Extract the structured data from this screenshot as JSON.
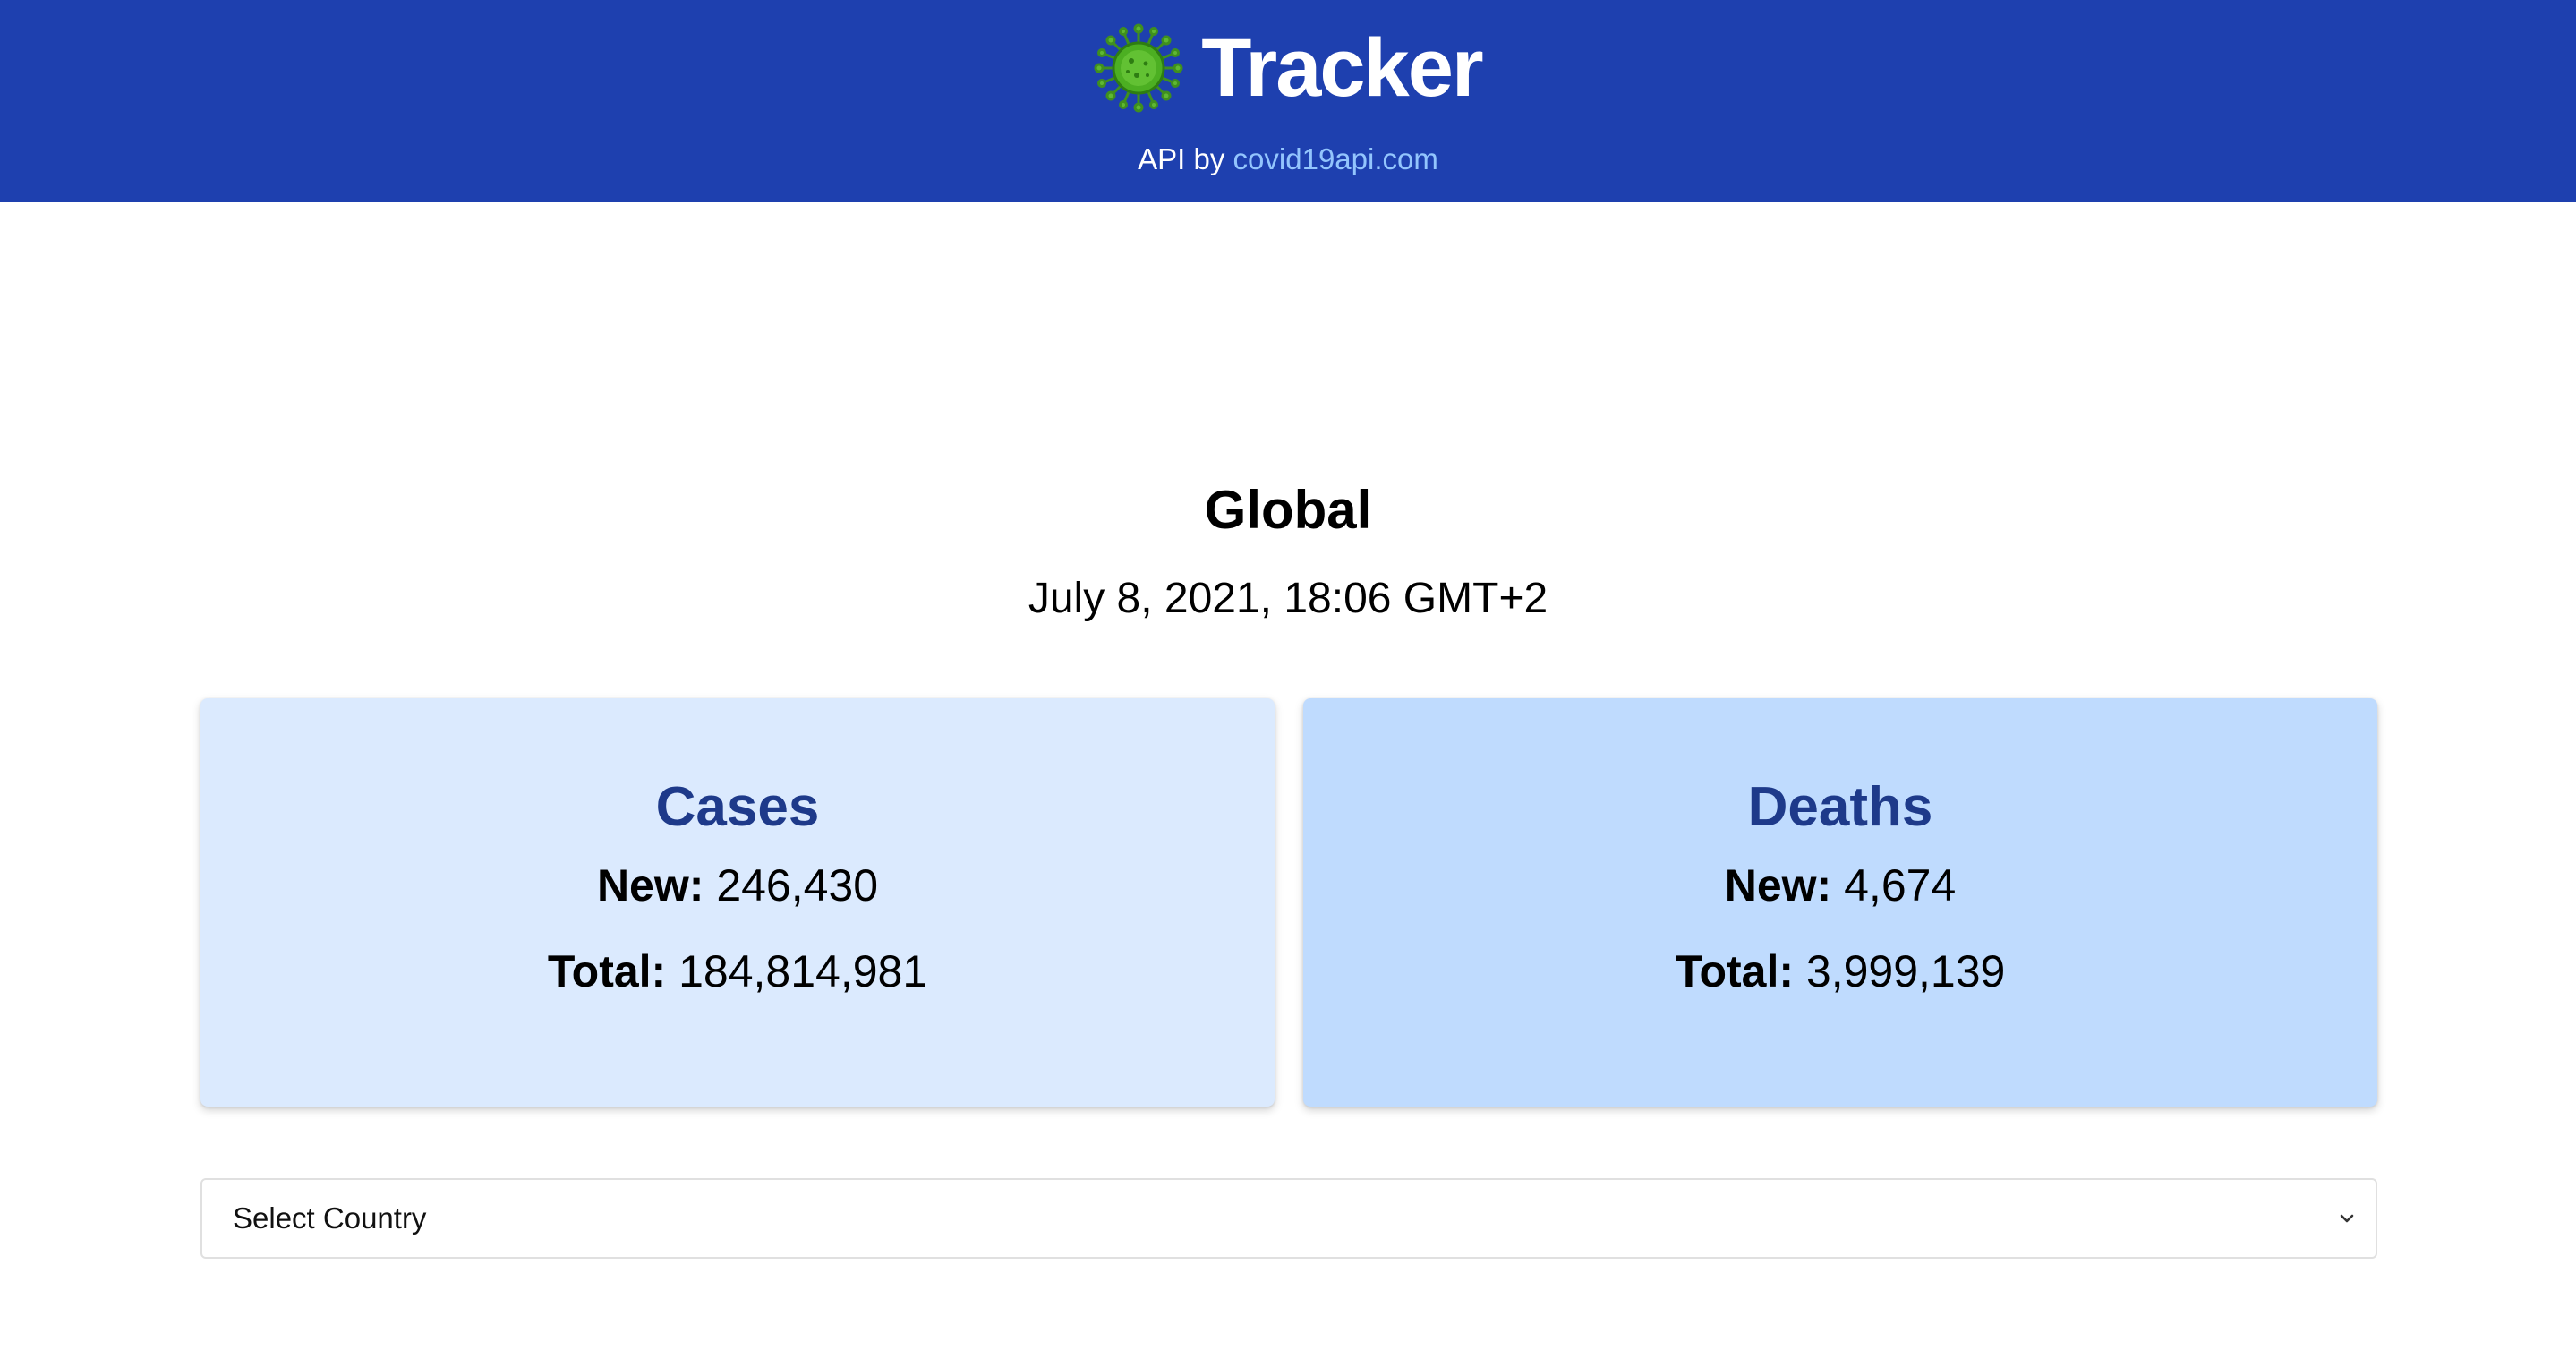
{
  "header": {
    "title": "Tracker",
    "api_prefix": "API by",
    "api_link_text": "covid19api.com",
    "background_color": "#1e40af",
    "link_color": "#93c5fd",
    "logo_icon": "virus-icon"
  },
  "summary": {
    "scope": "Global",
    "date": "July 8, 2021, 18:06 GMT+2"
  },
  "cards": {
    "cases": {
      "title": "Cases",
      "new_label": "New:",
      "new_value": "246,430",
      "total_label": "Total:",
      "total_value": "184,814,981",
      "background_color": "#dbeafe"
    },
    "deaths": {
      "title": "Deaths",
      "new_label": "New:",
      "new_value": "4,674",
      "total_label": "Total:",
      "total_value": "3,999,139",
      "background_color": "#bfdbfe"
    }
  },
  "country_select": {
    "selected": "Select Country",
    "icon": "chevron-down-icon"
  }
}
